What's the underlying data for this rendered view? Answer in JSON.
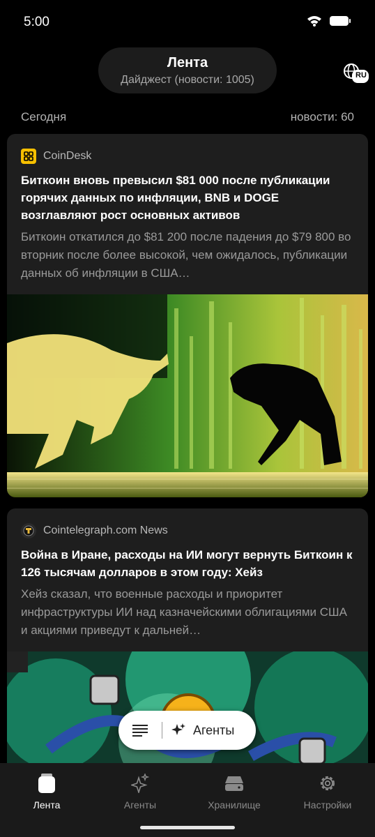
{
  "status": {
    "time": "5:00"
  },
  "header": {
    "title": "Лента",
    "subtitle": "Дайджест (новости: 1005)",
    "lang_badge": "RU"
  },
  "section": {
    "label": "Сегодня",
    "count": "новости: 60"
  },
  "articles": [
    {
      "source": "CoinDesk",
      "title": "Биткоин вновь превысил $81 000 после публикации горячих данных по инфляции, BNB и DOGE возглавляют рост основных активов",
      "excerpt": "Биткоин откатился до $81 200 после падения до $79 800 во вторник после более высокой, чем ожидалось, публикации данных об инфляции в США…"
    },
    {
      "source": "Cointelegraph.com News",
      "title": "Война в Иране, расходы на ИИ могут вернуть Биткоин к 126 тысячам долларов в этом году: Хейз",
      "excerpt": "Хейз сказал, что военные расходы и приоритет инфраструктуры ИИ над казначейскими облигациями США и акциями приведут к дальней…"
    }
  ],
  "fab": {
    "agents_label": "Агенты"
  },
  "nav": {
    "items": [
      {
        "label": "Лента"
      },
      {
        "label": "Агенты"
      },
      {
        "label": "Хранилище"
      },
      {
        "label": "Настройки"
      }
    ]
  },
  "colors": {
    "background": "#000000",
    "card": "#1e1e1e",
    "nav": "#1a1a1a",
    "coindesk": "#f7c000",
    "accent_green": "#3fb93f"
  }
}
